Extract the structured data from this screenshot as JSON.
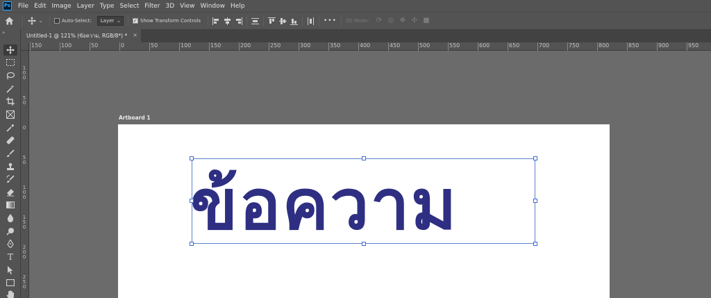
{
  "app": {
    "logo_text": "Ps",
    "menu": [
      "File",
      "Edit",
      "Image",
      "Layer",
      "Type",
      "Select",
      "Filter",
      "3D",
      "View",
      "Window",
      "Help"
    ]
  },
  "options_bar": {
    "auto_select_label": "Auto-Select:",
    "auto_select_checked": false,
    "layer_dropdown_value": "Layer",
    "show_transform_label": "Show Transform Controls",
    "show_transform_checked": true,
    "more_label": "•••",
    "mode_3d_label": "3D Mode:"
  },
  "document_tab": {
    "title": "Untitled-1 @ 121% (ข้อความ, RGB/8*) *",
    "close_glyph": "×"
  },
  "toolbar": {
    "collapse_glyph": "»",
    "tools": [
      "move-tool-icon",
      "marquee-tool-icon",
      "lasso-tool-icon",
      "magic-wand-tool-icon",
      "crop-tool-icon",
      "frame-tool-icon",
      "eyedropper-tool-icon",
      "healing-brush-tool-icon",
      "brush-tool-icon",
      "clone-stamp-tool-icon",
      "history-brush-tool-icon",
      "eraser-tool-icon",
      "gradient-tool-icon",
      "blur-tool-icon",
      "dodge-tool-icon",
      "pen-tool-icon",
      "type-tool-icon",
      "path-selection-tool-icon",
      "rectangle-tool-icon",
      "hand-tool-icon"
    ],
    "type_tool_glyph": "T"
  },
  "ruler_top": [
    "150",
    "100",
    "50",
    "0",
    "50",
    "100",
    "150",
    "200",
    "250",
    "300",
    "350",
    "400",
    "450",
    "500",
    "550",
    "600",
    "650",
    "700",
    "750",
    "800",
    "850",
    "900",
    "950"
  ],
  "ruler_left": [
    "1 0 0",
    "5 0",
    "0",
    "5 0",
    "1 0 0",
    "1 5 0",
    "2 0 0",
    "2 5 0"
  ],
  "canvas": {
    "artboard_label": "Artboard 1",
    "layer_text": "ข้อความ",
    "text_color": "#2e2f82",
    "accent_color": "#3e6ad0"
  }
}
